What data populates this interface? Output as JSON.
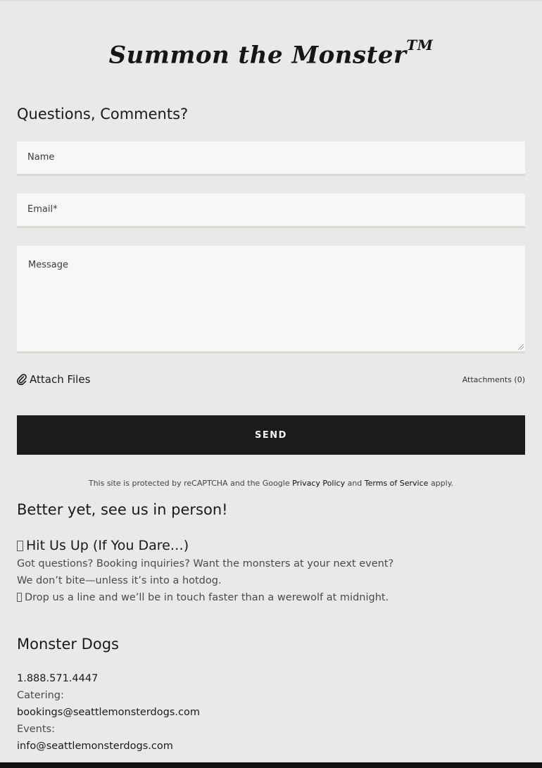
{
  "brand": {
    "name": "Summon the Monster",
    "mark": "TM"
  },
  "form": {
    "heading": "Questions, Comments?",
    "name_placeholder": "Name",
    "email_placeholder": "Email*",
    "message_placeholder": "Message",
    "attach_label": "Attach Files",
    "attachments_count": "Attachments (0)",
    "send_label": "SEND",
    "recaptcha": {
      "prefix": "This site is protected by reCAPTCHA and the Google",
      "privacy": "Privacy Policy",
      "and": "and",
      "terms": "Terms of Service",
      "suffix": "apply."
    }
  },
  "visit": {
    "heading": "Better yet, see us in person!",
    "subheading": "Hit Us Up (If You Dare…)",
    "line1": "Got questions? Booking inquiries? Want the monsters at your next event?",
    "line2": "We don’t bite—unless it’s into a hotdog.",
    "line3": "Drop us a line and we’ll be in touch faster than a werewolf at midnight."
  },
  "contact": {
    "business_name": "Monster Dogs",
    "phone": "1.888.571.4447",
    "catering_label": "Catering:",
    "catering_email": "bookings@seattlemonsterdogs.com",
    "events_label": "Events:",
    "events_email": "info@seattlemonsterdogs.com"
  },
  "colors": {
    "background": "#e9e9e7",
    "button": "#1b1b1b",
    "field": "#f7f7f5"
  },
  "icons": {
    "attach": "paperclip-icon"
  }
}
